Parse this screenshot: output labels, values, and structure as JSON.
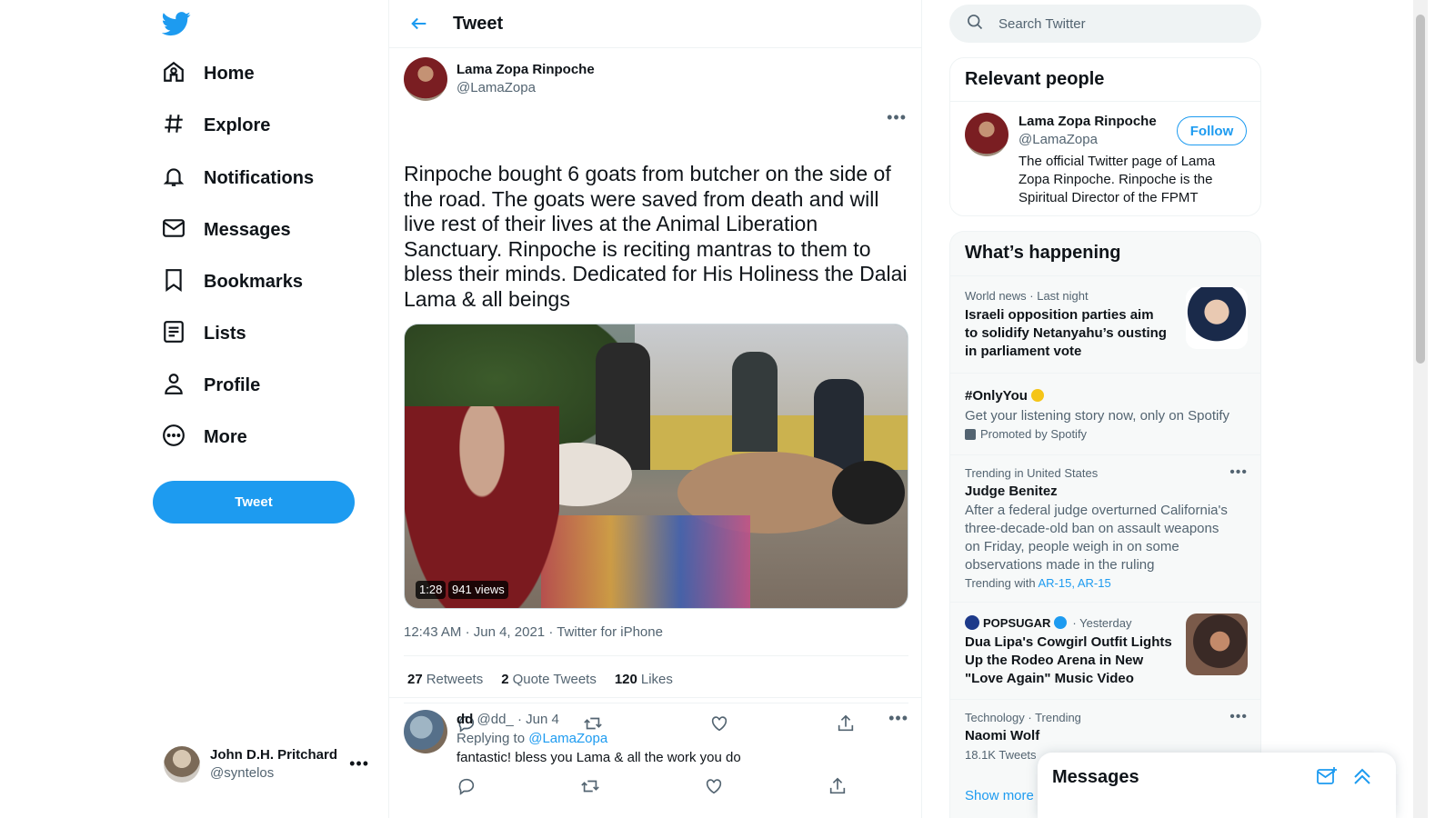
{
  "nav": {
    "items": [
      {
        "label": "Home",
        "icon": "home-icon"
      },
      {
        "label": "Explore",
        "icon": "hashtag-icon"
      },
      {
        "label": "Notifications",
        "icon": "bell-icon"
      },
      {
        "label": "Messages",
        "icon": "envelope-icon"
      },
      {
        "label": "Bookmarks",
        "icon": "bookmark-icon"
      },
      {
        "label": "Lists",
        "icon": "list-icon"
      },
      {
        "label": "Profile",
        "icon": "person-icon"
      },
      {
        "label": "More",
        "icon": "more-circle-icon"
      }
    ],
    "tweet_button": "Tweet",
    "account": {
      "name": "John D.H. Pritchard",
      "handle": "@syntelos"
    }
  },
  "main": {
    "title": "Tweet",
    "tweet": {
      "author_name": "Lama Zopa Rinpoche",
      "author_handle": "@LamaZopa",
      "text": "Rinpoche bought 6 goats from butcher on the side of the road. The goats were saved from death and will live rest of their lives at the Animal Liberation Sanctuary. Rinpoche is reciting mantras to them to bless their minds. Dedicated for His Holiness the Dalai Lama & all beings",
      "video_duration": "1:28",
      "video_views": "941 views",
      "time": "12:43 AM",
      "date": "Jun 4, 2021",
      "source": "Twitter for iPhone",
      "retweets_count": "27",
      "retweets_label": "Retweets",
      "quotes_count": "2",
      "quotes_label": "Quote Tweets",
      "likes_count": "120",
      "likes_label": "Likes"
    },
    "reply": {
      "name": "dd",
      "handle": "@dd_",
      "date": "Jun 4",
      "replying_prefix": "Replying to",
      "replying_to": "@LamaZopa",
      "text": "fantastic! bless you Lama & all the work you do"
    }
  },
  "right": {
    "search_placeholder": "Search Twitter",
    "relevant": {
      "title": "Relevant people",
      "name": "Lama Zopa Rinpoche",
      "handle": "@LamaZopa",
      "follow_label": "Follow",
      "bio": "The official Twitter page of Lama Zopa Rinpoche. Rinpoche is the Spiritual Director of the FPMT"
    },
    "happening": {
      "title": "What’s happening",
      "trends": [
        {
          "context": "World news · Last night",
          "headline": "Israeli opposition parties aim to solidify Netanyahu’s ousting in parliament vote"
        },
        {
          "headline": "#OnlyYou",
          "desc": "Get your listening story now, only on Spotify",
          "promoted": "Promoted by Spotify"
        },
        {
          "context": "Trending in United States",
          "headline": "Judge Benitez",
          "desc": "After a federal judge overturned California's three-decade-old ban on assault weapons on Friday, people weigh in on some observations made in the ruling",
          "trending_with_label": "Trending with",
          "trending_with": "AR-15, AR-15"
        },
        {
          "source": "POPSUGAR",
          "context": "· Yesterday",
          "headline": "Dua Lipa's Cowgirl Outfit Lights Up the Rodeo Arena in New \"Love Again\" Music Video"
        },
        {
          "context": "Technology · Trending",
          "headline": "Naomi Wolf",
          "desc": "18.1K Tweets"
        }
      ],
      "show_more": "Show more"
    }
  },
  "messages_drawer": {
    "title": "Messages"
  },
  "colors": {
    "accent": "#1d9bf0",
    "text": "#0f1419",
    "secondary": "#536471"
  }
}
